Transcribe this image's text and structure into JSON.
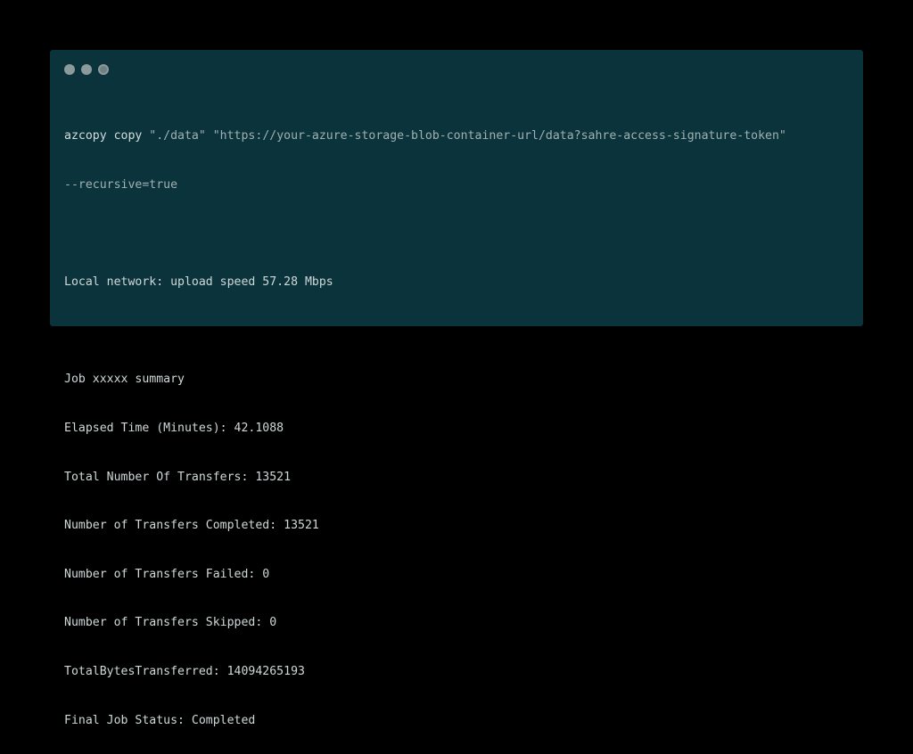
{
  "window": {
    "controls": [
      "close-dot",
      "minimize-dot",
      "maximize-dot"
    ]
  },
  "command": {
    "program": "azcopy copy",
    "args_line1": " \"./data\" \"https://your-azure-storage-blob-container-url/data?sahre-access-signature-token\"",
    "args_line2": "--recursive=true"
  },
  "output": {
    "network": "Local network: upload speed 57.28 Mbps",
    "summary_header": "Job xxxxx summary",
    "elapsed": "Elapsed Time (Minutes): 42.1088",
    "total_transfers": "Total Number Of Transfers: 13521",
    "completed": "Number of Transfers Completed: 13521",
    "failed": "Number of Transfers Failed: 0",
    "skipped": "Number of Transfers Skipped: 0",
    "bytes": "TotalBytesTransferred: 14094265193",
    "status": "Final Job Status: Completed"
  },
  "colors": {
    "page_background": "#000000",
    "terminal_background": "#0b333b",
    "text": "#cfd8d9",
    "dots": "#8c9a9c"
  }
}
